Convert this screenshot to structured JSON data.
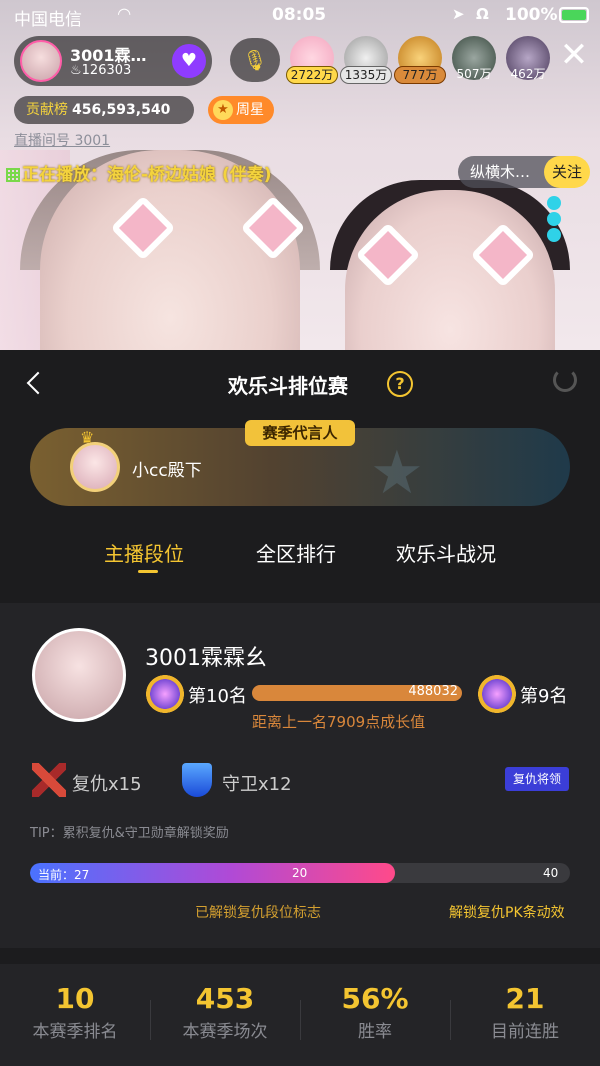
{
  "status_bar": {
    "carrier": "中国电信",
    "time": "08:05",
    "battery": "100%"
  },
  "anchor": {
    "name": "3001霖…",
    "fans": "126303"
  },
  "viewers": [
    {
      "count": "2722万"
    },
    {
      "count": "1335万"
    },
    {
      "count": "777万"
    },
    {
      "count": "507万"
    },
    {
      "count": "462万"
    }
  ],
  "contribution": {
    "label": "贡献榜",
    "value": "456,593,540"
  },
  "week_star": "周星",
  "room_no": "直播间号 3001",
  "now_playing": "正在播放：海伦-桥边姑娘 (伴奏)",
  "pk": {
    "opponent": "纵横木…",
    "follow": "关注"
  },
  "panel": {
    "title": "欢乐斗排位赛",
    "help": "?",
    "ambassador_tag": "赛季代言人",
    "ambassador_name": "小cc殿下",
    "tabs": [
      "主播段位",
      "全区排行",
      "欢乐斗战况"
    ],
    "me": {
      "name": "3001霖霖幺",
      "current_rank": "第10名",
      "next_rank": "第9名",
      "points": "488032",
      "gap_note": "距离上一名7909点成长值"
    },
    "medals": {
      "revenge_label": "复仇",
      "revenge_count": "x15",
      "guard_label": "守卫",
      "guard_count": "x12",
      "revenge_general": "复仇将领"
    },
    "tip": "TIP：累积复仇&守卫勋章解锁奖励",
    "progress": {
      "current_label": "当前：27",
      "current": 27,
      "mid_label": "20",
      "max_label": "40"
    },
    "unlock_note": "已解锁复仇段位标志",
    "unlock_link": "解锁复仇PK条动效",
    "stats": [
      {
        "value": "10",
        "label": "本赛季排名"
      },
      {
        "value": "453",
        "label": "本赛季场次"
      },
      {
        "value": "56%",
        "label": "胜率"
      },
      {
        "value": "21",
        "label": "目前连胜"
      }
    ]
  },
  "colors": {
    "accent": "#f4c531",
    "progress": "#d9873b",
    "button_blue": "#3b3ed8"
  }
}
